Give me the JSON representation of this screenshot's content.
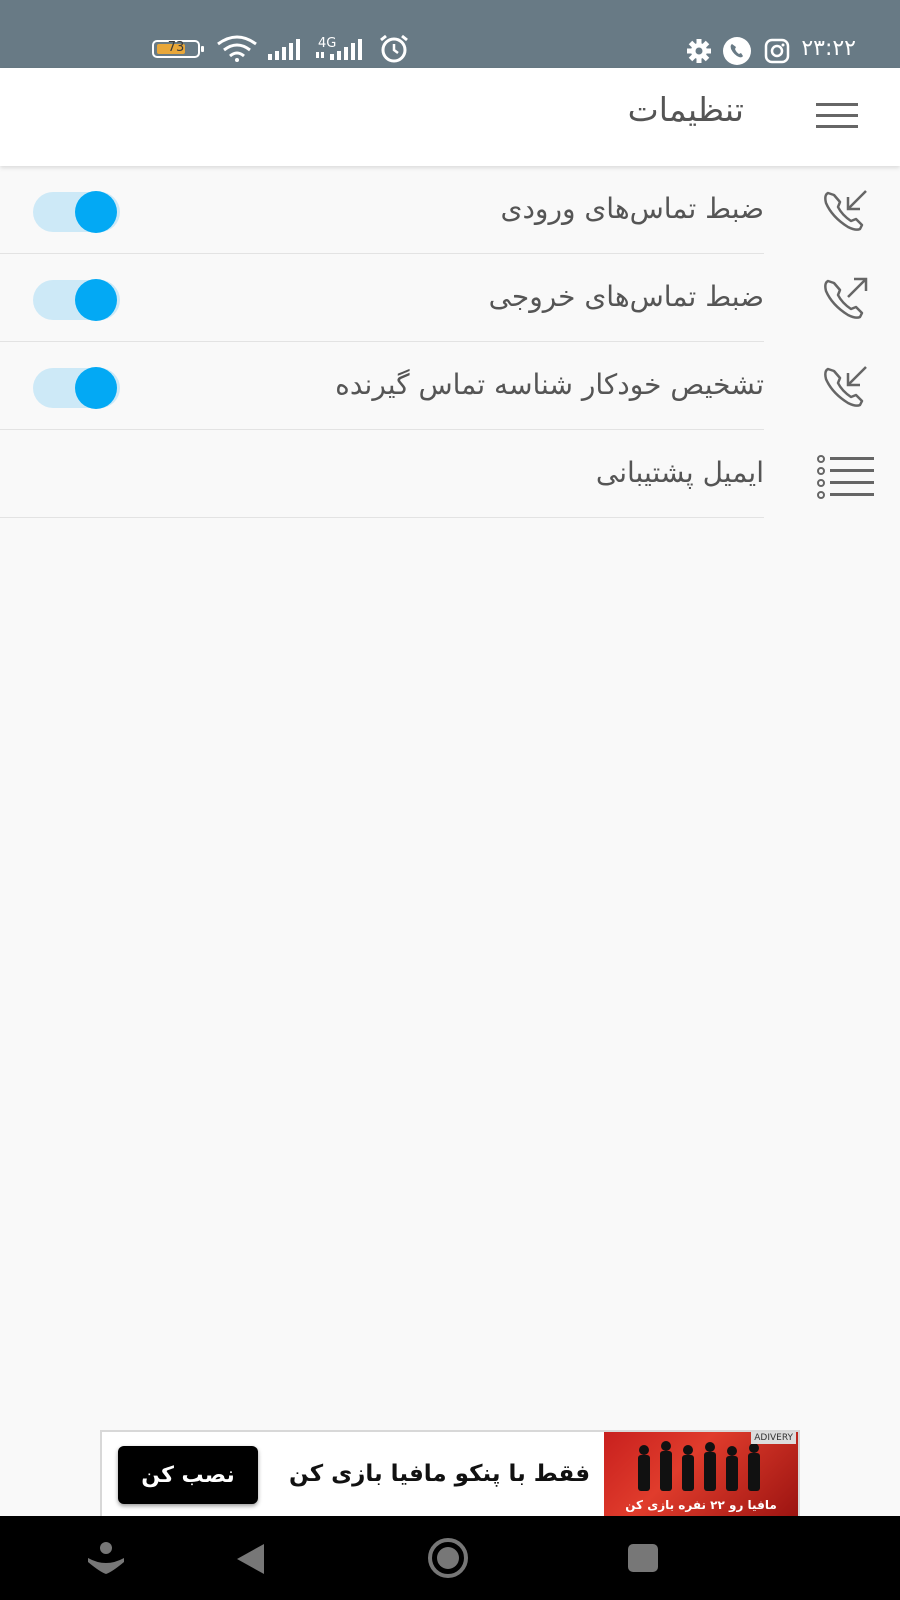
{
  "status_bar": {
    "time": "۲۳:۲۲",
    "battery_level": "73",
    "network_type": "4G",
    "icons": [
      "instagram-icon",
      "phone-icon",
      "gear-icon",
      "alarm-icon",
      "signal-icon",
      "wifi-icon",
      "battery-icon"
    ]
  },
  "app_bar": {
    "title": "تنظیمات",
    "menu_icon": "hamburger-menu-icon"
  },
  "settings": [
    {
      "label": "ضبط تماس‌های ورودی",
      "icon": "incoming-call-icon",
      "toggle": true
    },
    {
      "label": "ضبط تماس‌های خروجی",
      "icon": "outgoing-call-icon",
      "toggle": true
    },
    {
      "label": "تشخیص خودکار شناسه تماس گیرنده",
      "icon": "incoming-call-icon",
      "toggle": true
    },
    {
      "label": "ایمیل پشتیبانی",
      "icon": "list-icon",
      "toggle": null
    }
  ],
  "ad_banner": {
    "text": "فقط با پنکو مافیا بازی کن",
    "button_label": "نصب کن",
    "image_caption": "مافیا رو ۲۲ نفره بازی کن",
    "brand": "ADIVERY"
  },
  "colors": {
    "status_bar": "#687a85",
    "accent": "#03a9f4",
    "toggle_track": "#cde9f7",
    "background": "#f9f9f9"
  },
  "nav_bar": {
    "icons": [
      "assistant-icon",
      "back-icon",
      "home-icon",
      "recents-icon"
    ]
  }
}
